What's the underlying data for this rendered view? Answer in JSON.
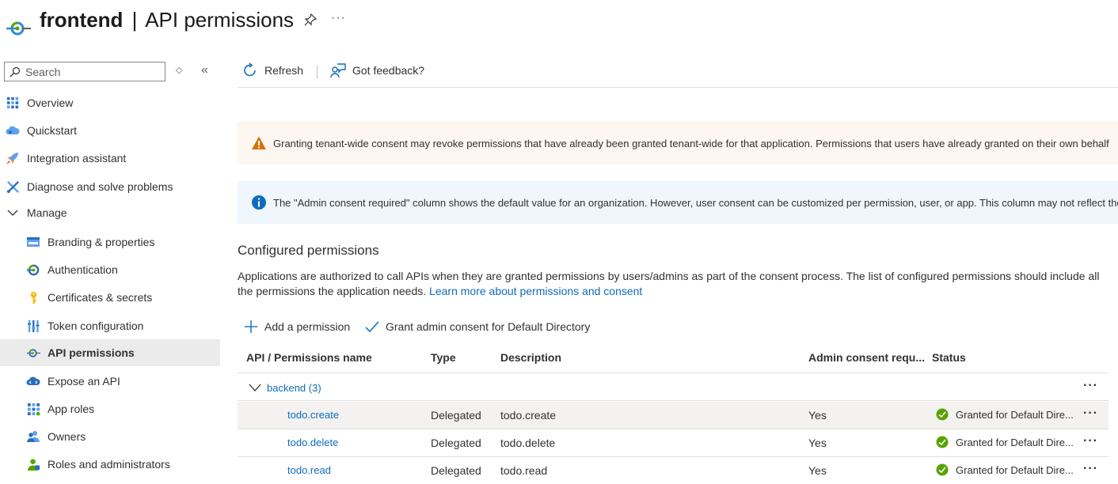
{
  "header": {
    "app_name": "frontend",
    "separator": "|",
    "page_title": "API permissions",
    "more_label": "···"
  },
  "sidebar": {
    "search_placeholder": "Search",
    "sort_glyph": "◇",
    "collapse_glyph": "«",
    "items": [
      {
        "label": "Overview",
        "icon": "overview-grid-icon"
      },
      {
        "label": "Quickstart",
        "icon": "cloud-icon"
      },
      {
        "label": "Integration assistant",
        "icon": "rocket-icon"
      },
      {
        "label": "Diagnose and solve problems",
        "icon": "wrench-icon"
      },
      {
        "label": "Manage",
        "icon": "chevron-down-icon"
      },
      {
        "label": "Branding & properties",
        "icon": "branding-icon"
      },
      {
        "label": "Authentication",
        "icon": "authentication-icon"
      },
      {
        "label": "Certificates & secrets",
        "icon": "key-icon"
      },
      {
        "label": "Token configuration",
        "icon": "token-bars-icon"
      },
      {
        "label": "API permissions",
        "icon": "api-permissions-icon"
      },
      {
        "label": "Expose an API",
        "icon": "cloud-api-icon"
      },
      {
        "label": "App roles",
        "icon": "app-roles-icon"
      },
      {
        "label": "Owners",
        "icon": "owners-icon"
      },
      {
        "label": "Roles and administrators",
        "icon": "roles-admin-icon"
      }
    ]
  },
  "toolbar": {
    "refresh_label": "Refresh",
    "feedback_label": "Got feedback?"
  },
  "banners": {
    "warning_text": "Granting tenant-wide consent may revoke permissions that have already been granted tenant-wide for that application. Permissions that users have already granted on their own behalf",
    "info_text": "The \"Admin consent required\" column shows the default value for an organization. However, user consent can be customized per permission, user, or app. This column may not reflect the"
  },
  "configured": {
    "title": "Configured permissions",
    "description": "Applications are authorized to call APIs when they are granted permissions by users/admins as part of the consent process. The list of configured permissions should include all the permissions the application needs.",
    "learn_more": "Learn more about permissions and consent",
    "add_permission_label": "Add a permission",
    "grant_consent_label": "Grant admin consent for Default Directory"
  },
  "table": {
    "headers": [
      "API / Permissions name",
      "Type",
      "Description",
      "Admin consent requ...",
      "Status"
    ],
    "group_label": "backend (3)",
    "group_more": "···",
    "rows": [
      {
        "name": "todo.create",
        "type": "Delegated",
        "description": "todo.create",
        "admin_consent": "Yes",
        "status": "Granted for Default Dire...",
        "more": "···"
      },
      {
        "name": "todo.delete",
        "type": "Delegated",
        "description": "todo.delete",
        "admin_consent": "Yes",
        "status": "Granted for Default Dire...",
        "more": "···"
      },
      {
        "name": "todo.read",
        "type": "Delegated",
        "description": "todo.read",
        "admin_consent": "Yes",
        "status": "Granted for Default Dire...",
        "more": "···"
      }
    ]
  },
  "colors": {
    "link": "#0f6cbd",
    "warning_bg": "#fdf6f1",
    "info_bg": "#eff6fc",
    "success": "#57a300",
    "active_nav_bg": "#ebebeb"
  }
}
